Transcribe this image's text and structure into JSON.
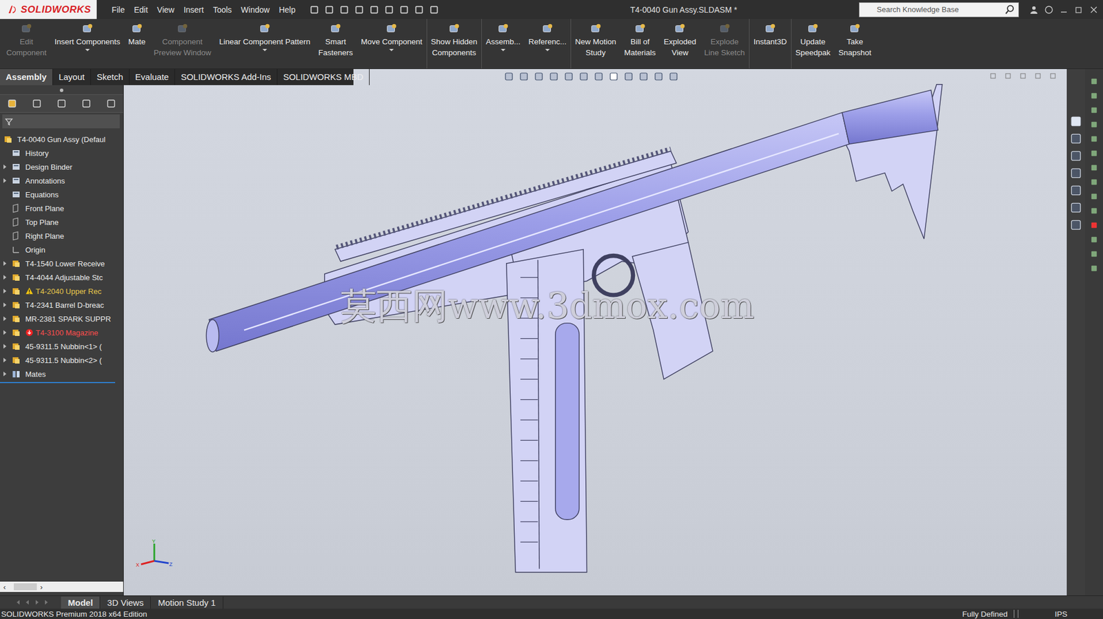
{
  "window": {
    "logo": "SOLIDWORKS",
    "title": "T4-0040 Gun Assy.SLDASM *"
  },
  "menu": [
    "File",
    "Edit",
    "View",
    "Insert",
    "Tools",
    "Window",
    "Help"
  ],
  "search": {
    "placeholder": "Search Knowledge Base"
  },
  "ribbon": [
    {
      "lines": [
        "Edit",
        "Component"
      ],
      "disabled": true,
      "dropdown": false,
      "separator_after": false
    },
    {
      "lines": [
        "Insert Components"
      ],
      "disabled": false,
      "dropdown": true,
      "separator_after": false
    },
    {
      "lines": [
        "Mate"
      ],
      "disabled": false,
      "dropdown": false,
      "separator_after": false
    },
    {
      "lines": [
        "Component",
        "Preview Window"
      ],
      "disabled": true,
      "dropdown": false,
      "separator_after": false
    },
    {
      "lines": [
        "Linear Component Pattern"
      ],
      "disabled": false,
      "dropdown": true,
      "separator_after": false
    },
    {
      "lines": [
        "Smart",
        "Fasteners"
      ],
      "disabled": false,
      "dropdown": false,
      "separator_after": false
    },
    {
      "lines": [
        "Move Component"
      ],
      "disabled": false,
      "dropdown": true,
      "separator_after": true
    },
    {
      "lines": [
        "Show Hidden",
        "Components"
      ],
      "disabled": false,
      "dropdown": false,
      "separator_after": true
    },
    {
      "lines": [
        "Assemb..."
      ],
      "disabled": false,
      "dropdown": true,
      "separator_after": false
    },
    {
      "lines": [
        "Referenc..."
      ],
      "disabled": false,
      "dropdown": true,
      "separator_after": true
    },
    {
      "lines": [
        "New Motion",
        "Study"
      ],
      "disabled": false,
      "dropdown": false,
      "separator_after": false
    },
    {
      "lines": [
        "Bill of",
        "Materials"
      ],
      "disabled": false,
      "dropdown": false,
      "separator_after": false
    },
    {
      "lines": [
        "Exploded",
        "View"
      ],
      "disabled": false,
      "dropdown": false,
      "separator_after": false
    },
    {
      "lines": [
        "Explode",
        "Line Sketch"
      ],
      "disabled": true,
      "dropdown": false,
      "separator_after": true
    },
    {
      "lines": [
        "Instant3D"
      ],
      "disabled": false,
      "dropdown": false,
      "separator_after": true
    },
    {
      "lines": [
        "Update",
        "Speedpak"
      ],
      "disabled": false,
      "dropdown": false,
      "separator_after": false
    },
    {
      "lines": [
        "Take",
        "Snapshot"
      ],
      "disabled": false,
      "dropdown": false,
      "separator_after": false
    }
  ],
  "tabs": [
    {
      "label": "Assembly",
      "selected": true
    },
    {
      "label": "Layout",
      "selected": false
    },
    {
      "label": "Sketch",
      "selected": false
    },
    {
      "label": "Evaluate",
      "selected": false
    },
    {
      "label": "SOLIDWORKS Add-Ins",
      "selected": false
    },
    {
      "label": "SOLIDWORKS MBD",
      "selected": false
    }
  ],
  "tree": {
    "root": "T4-0040 Gun Assy  (Defaul",
    "items": [
      {
        "label": "History",
        "kind": "folder",
        "expandable": false,
        "status": "ok"
      },
      {
        "label": "Design Binder",
        "kind": "folder",
        "expandable": true,
        "status": "ok"
      },
      {
        "label": "Annotations",
        "kind": "folder",
        "expandable": true,
        "status": "ok"
      },
      {
        "label": "Equations",
        "kind": "folder",
        "expandable": false,
        "status": "ok"
      },
      {
        "label": "Front Plane",
        "kind": "plane",
        "expandable": false,
        "status": "ok"
      },
      {
        "label": "Top Plane",
        "kind": "plane",
        "expandable": false,
        "status": "ok"
      },
      {
        "label": "Right Plane",
        "kind": "plane",
        "expandable": false,
        "status": "ok"
      },
      {
        "label": "Origin",
        "kind": "origin",
        "expandable": false,
        "status": "ok"
      },
      {
        "label": "T4-1540 Lower Receive",
        "kind": "part",
        "expandable": true,
        "status": "ok"
      },
      {
        "label": "T4-4044 Adjustable Stc",
        "kind": "part",
        "expandable": true,
        "status": "ok"
      },
      {
        "label": "T4-2040 Upper Rec",
        "kind": "part",
        "expandable": true,
        "status": "warning"
      },
      {
        "label": "T4-2341 Barrel D-breac",
        "kind": "part",
        "expandable": true,
        "status": "ok"
      },
      {
        "label": "MR-2381 SPARK SUPPR",
        "kind": "part",
        "expandable": true,
        "status": "ok"
      },
      {
        "label": "T4-3100 Magazine",
        "kind": "part",
        "expandable": true,
        "status": "error"
      },
      {
        "label": "45-9311.5 Nubbin<1> (",
        "kind": "part",
        "expandable": true,
        "status": "ok"
      },
      {
        "label": "45-9311.5 Nubbin<2> (",
        "kind": "part",
        "expandable": true,
        "status": "ok"
      },
      {
        "label": "Mates",
        "kind": "mates",
        "expandable": true,
        "status": "ok"
      }
    ]
  },
  "viewport": {
    "watermark": "莫西网www.3dmox.com",
    "triad": {
      "x": "X",
      "y": "Y",
      "z": "Z"
    }
  },
  "bottom_tabs": [
    {
      "label": "Model",
      "selected": true
    },
    {
      "label": "3D Views",
      "selected": false
    },
    {
      "label": "Motion Study 1",
      "selected": false
    }
  ],
  "status_bar": {
    "edition": "SOLIDWORKS Premium 2018 x64 Edition",
    "state": "Fully Defined",
    "units": "IPS"
  }
}
